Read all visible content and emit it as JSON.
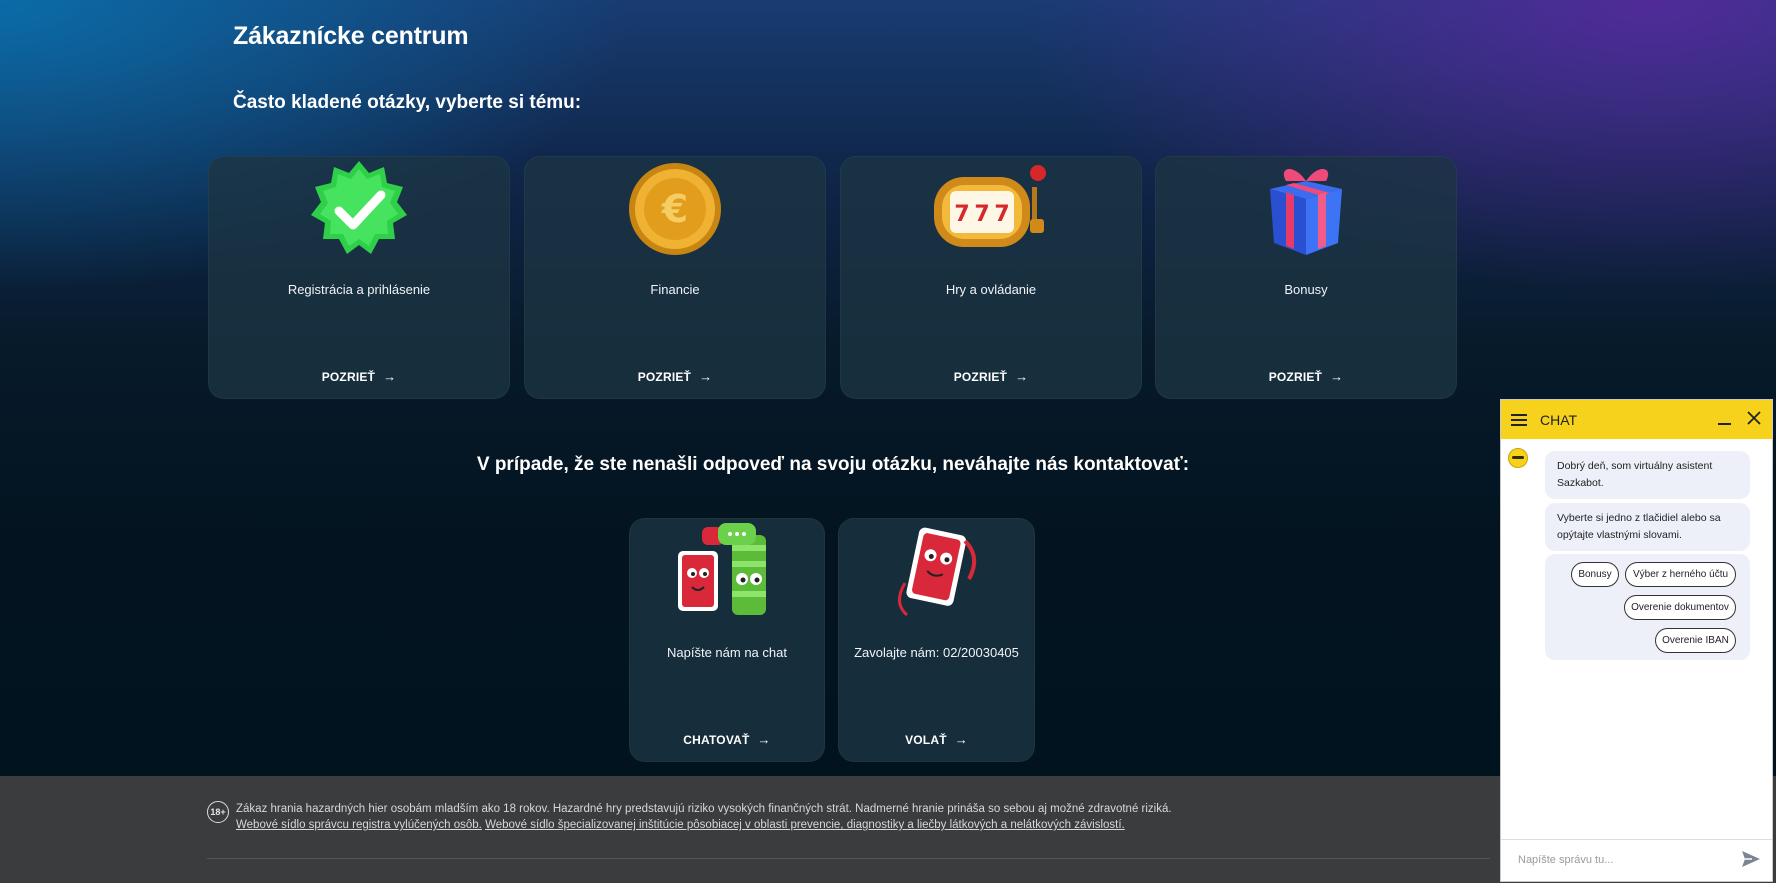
{
  "header": {
    "title": "Zákaznícke centrum",
    "faq_heading": "Často kladené otázky, vyberte si tému:"
  },
  "faq_cards": [
    {
      "title": "Registrácia a prihlásenie",
      "cta": "POZRIEŤ",
      "icon": "verified-badge-icon"
    },
    {
      "title": "Financie",
      "cta": "POZRIEŤ",
      "icon": "euro-coin-icon"
    },
    {
      "title": "Hry a ovládanie",
      "cta": "POZRIEŤ",
      "icon": "slot-machine-icon"
    },
    {
      "title": "Bonusy",
      "cta": "POZRIEŤ",
      "icon": "gift-icon"
    }
  ],
  "contact": {
    "heading": "V prípade, že ste nenašli odpoveď na svoju otázku, neváhajte nás kontaktovať:",
    "cards": [
      {
        "title": "Napíšte nám na chat",
        "cta": "CHATOVAŤ",
        "icon": "chat-mascots-icon"
      },
      {
        "title": "Zavolajte nám: 02/20030405",
        "cta": "VOLAŤ",
        "icon": "phone-mascot-icon"
      }
    ]
  },
  "footer": {
    "age_badge": "18+",
    "disclaimer": "Zákaz hrania hazardných hier osobám mladším ako 18 rokov. Hazardné hry predstavujú riziko vysokých finančných strát. Nadmerné hranie prináša so sebou aj možné zdravotné riziká.",
    "link1": "Webové sídlo správcu registra vylúčených osôb.",
    "link2": "Webové sídlo špecializovanej inštitúcie pôsobiacej v oblasti prevencie, diagnostiky a liečby látkových a nelátkových závislostí."
  },
  "chat": {
    "title": "CHAT",
    "messages": [
      "Dobrý deň, som virtuálny asistent Sazkabot.",
      "Vyberte si jedno z tlačidiel alebo sa opýtajte vlastnými slovami."
    ],
    "quick_replies": [
      "Bonusy",
      "Výber z herného účtu",
      "Overenie dokumentov",
      "Overenie IBAN"
    ],
    "input_placeholder": "Napíšte správu tu..."
  },
  "colors": {
    "accent_yellow": "#f7d21c",
    "card_bg": "#1c3442",
    "footer_bg": "#3b3c3e"
  }
}
